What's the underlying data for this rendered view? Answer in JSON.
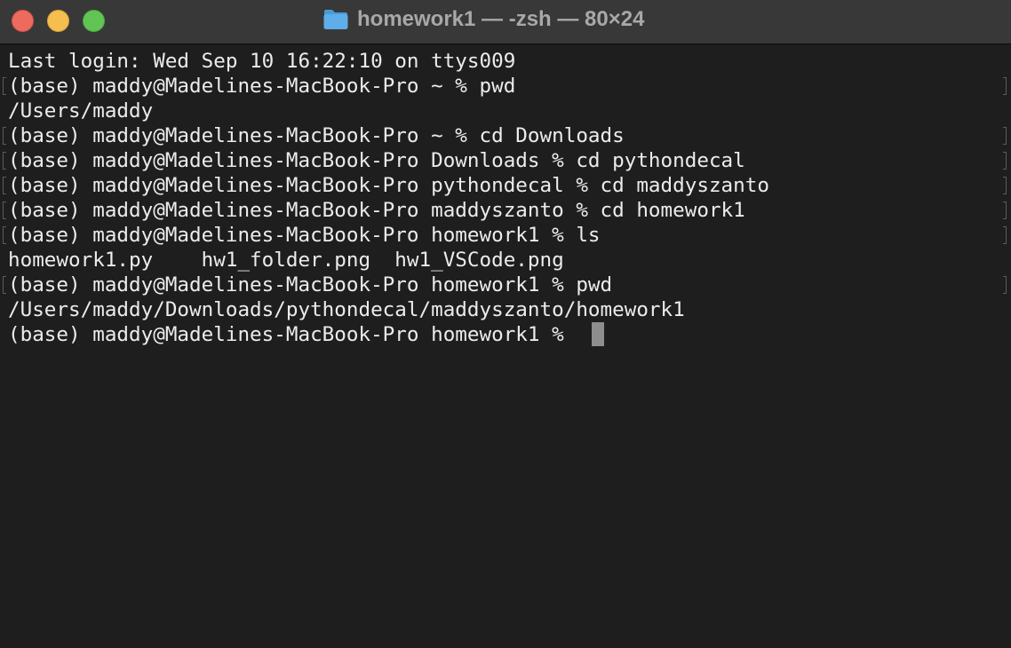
{
  "window": {
    "title": "homework1 — -zsh — 80×24",
    "title_icon": "folder-icon"
  },
  "terminal": {
    "lines": [
      "Last login: Wed Sep 10 16:22:10 on ttys009",
      "(base) maddy@Madelines-MacBook-Pro ~ % pwd",
      "/Users/maddy",
      "(base) maddy@Madelines-MacBook-Pro ~ % cd Downloads",
      "(base) maddy@Madelines-MacBook-Pro Downloads % cd pythondecal",
      "(base) maddy@Madelines-MacBook-Pro pythondecal % cd maddyszanto",
      "(base) maddy@Madelines-MacBook-Pro maddyszanto % cd homework1",
      "(base) maddy@Madelines-MacBook-Pro homework1 % ls",
      "homework1.py    hw1_folder.png  hw1_VSCode.png",
      "(base) maddy@Madelines-MacBook-Pro homework1 % pwd",
      "/Users/maddy/Downloads/pythondecal/maddyszanto/homework1",
      "(base) maddy@Madelines-MacBook-Pro homework1 % "
    ]
  },
  "colors": {
    "background": "#1e1e1e",
    "titlebar": "#383838",
    "text": "#ececec",
    "title_text": "#a8a8a8",
    "close": "#ec6a5e",
    "minimize": "#f4bf4f",
    "zoom": "#61c554",
    "folder": "#5eaeea",
    "cursor": "#8e8e8e"
  }
}
